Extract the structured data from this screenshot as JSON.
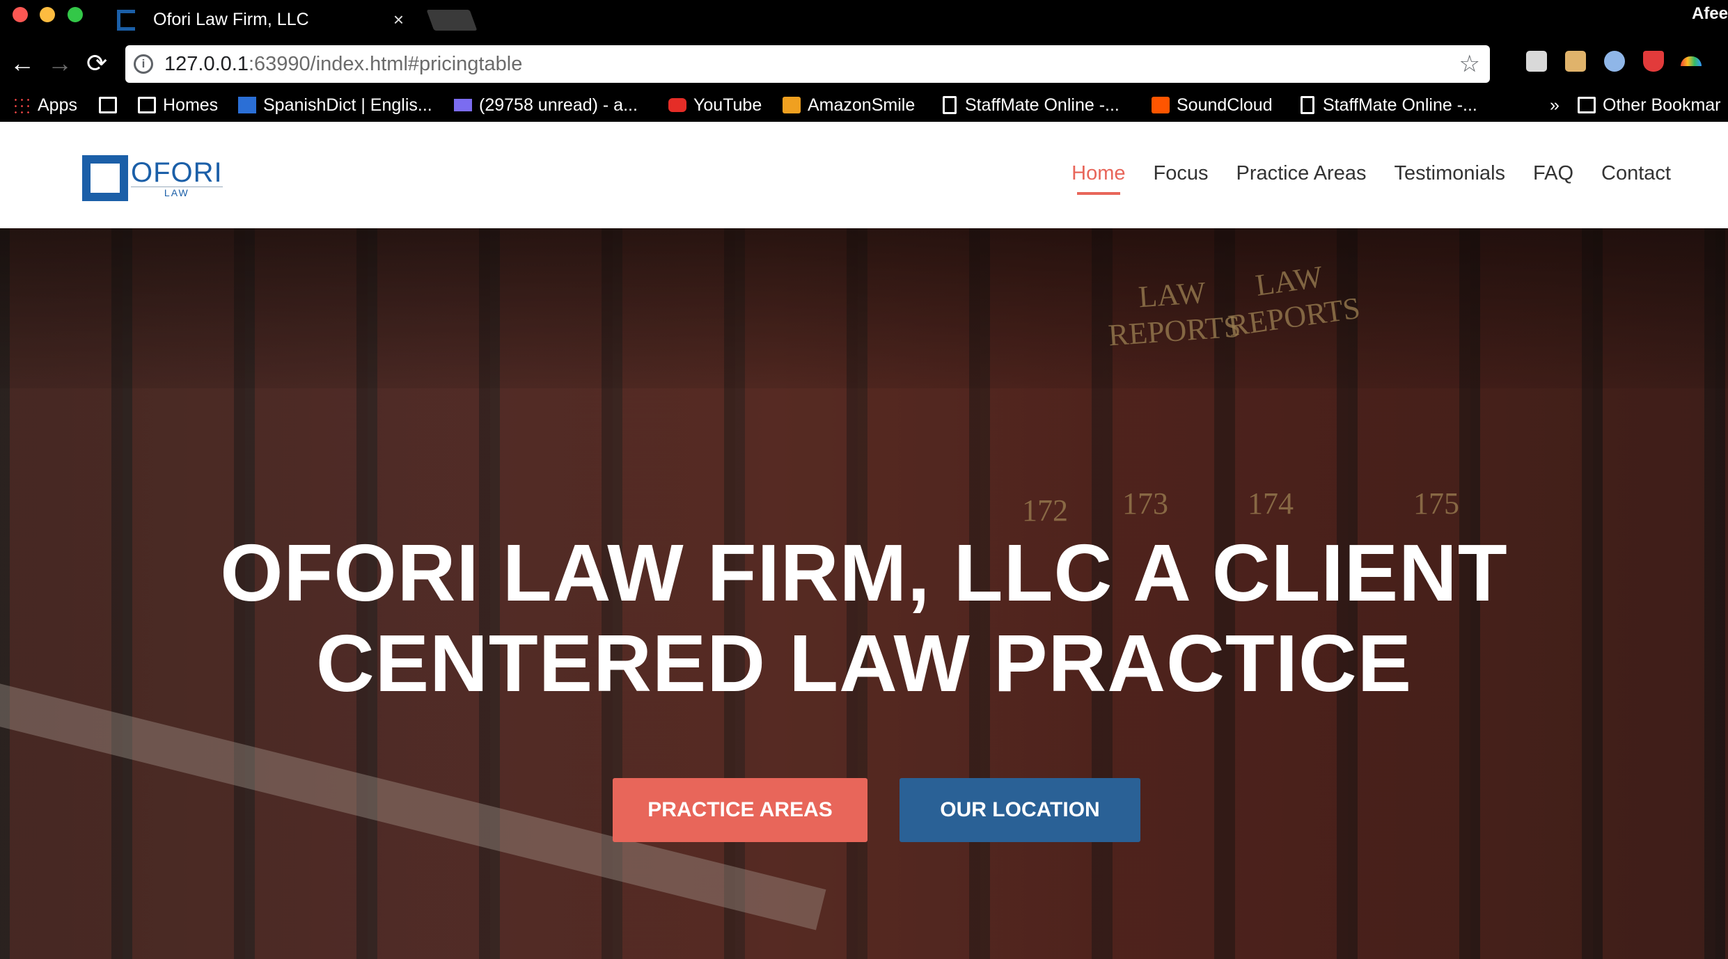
{
  "browser": {
    "tab_title": "Ofori Law Firm, LLC",
    "tab_close": "×",
    "profile_name": "Afee",
    "url_host": "127.0.0.1",
    "url_rest": ":63990/index.html#pricingtable",
    "nav": {
      "back": "←",
      "forward": "→",
      "reload": "⟳",
      "star": "☆"
    },
    "bookmarks": [
      {
        "label": "Apps",
        "icon": "apps-grid-icon"
      },
      {
        "label": "",
        "icon": "folder-icon"
      },
      {
        "label": "Homes",
        "icon": "folder-icon"
      },
      {
        "label": "SpanishDict | Englis...",
        "icon": "spanishdict-icon"
      },
      {
        "label": "(29758 unread) - a...",
        "icon": "mail-icon"
      },
      {
        "label": "YouTube",
        "icon": "youtube-icon"
      },
      {
        "label": "AmazonSmile",
        "icon": "amazon-icon"
      },
      {
        "label": "StaffMate Online -...",
        "icon": "page-icon"
      },
      {
        "label": "SoundCloud",
        "icon": "soundcloud-icon"
      },
      {
        "label": "StaffMate Online -...",
        "icon": "page-icon"
      }
    ],
    "bookmarks_overflow": "»",
    "other_bookmarks": "Other Bookmar"
  },
  "site": {
    "logo_name": "OFORI",
    "logo_sub": "LAW",
    "menu": [
      {
        "label": "Home",
        "active": true
      },
      {
        "label": "Focus",
        "active": false
      },
      {
        "label": "Practice Areas",
        "active": false
      },
      {
        "label": "Testimonials",
        "active": false
      },
      {
        "label": "FAQ",
        "active": false
      },
      {
        "label": "Contact",
        "active": false
      }
    ]
  },
  "hero": {
    "title_line1": "OFORI LAW FIRM, LLC A CLIENT",
    "title_line2": "CENTERED LAW PRACTICE",
    "btn_practice": "PRACTICE AREAS",
    "btn_location": "OUR LOCATION",
    "spines": {
      "law1": "LAW",
      "reports1": "REPORTS",
      "law2": "LAW",
      "reports2": "REPORTS",
      "vol172": "172",
      "vol173": "173",
      "vol174": "174",
      "vol175": "175"
    }
  },
  "colors": {
    "accent": "#e8665a",
    "secondary": "#2a6196",
    "logo_blue": "#1b5fa8"
  }
}
